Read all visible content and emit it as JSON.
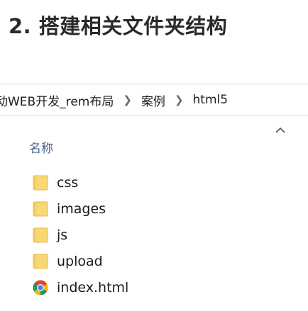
{
  "slide": {
    "title": "2. 搭建相关文件夹结构"
  },
  "explorer": {
    "breadcrumb": [
      "动WEB开发_rem布局",
      "案例",
      "html5"
    ],
    "column_header": "名称",
    "items": [
      {
        "name": "css",
        "icon": "folder-icon"
      },
      {
        "name": "images",
        "icon": "folder-icon"
      },
      {
        "name": "js",
        "icon": "folder-icon"
      },
      {
        "name": "upload",
        "icon": "folder-icon"
      },
      {
        "name": "index.html",
        "icon": "chrome-icon"
      }
    ]
  },
  "colors": {
    "folder_fill": "#f8d775",
    "folder_edge": "#e6b84a",
    "header_text": "#4a6785"
  }
}
